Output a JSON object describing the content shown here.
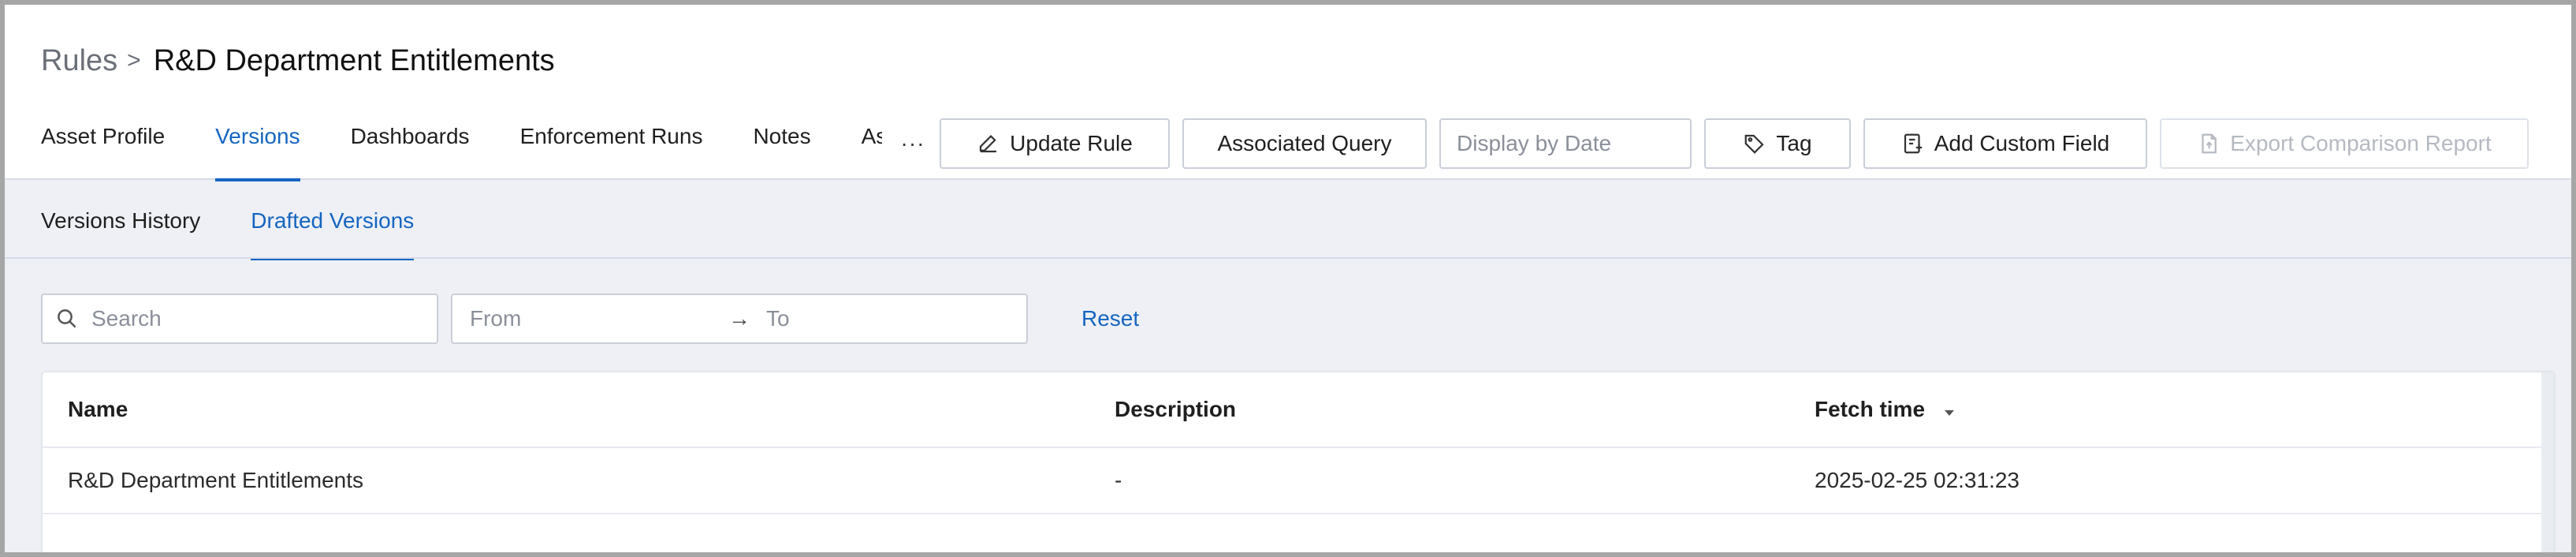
{
  "breadcrumb": {
    "root": "Rules",
    "separator": ">",
    "current": "R&D Department Entitlements"
  },
  "tabs": [
    {
      "label": "Asset Profile",
      "active": false
    },
    {
      "label": "Versions",
      "active": true
    },
    {
      "label": "Dashboards",
      "active": false
    },
    {
      "label": "Enforcement Runs",
      "active": false
    },
    {
      "label": "Notes",
      "active": false
    },
    {
      "label": "As",
      "active": false
    }
  ],
  "toolbar": {
    "more_label": "···",
    "update_rule": "Update Rule",
    "associated_query": "Associated Query",
    "display_by_date_placeholder": "Display by Date",
    "tag": "Tag",
    "add_custom_field": "Add Custom Field",
    "export_comparison_report": "Export Comparison Report"
  },
  "subtabs": [
    {
      "label": "Versions History",
      "active": false
    },
    {
      "label": "Drafted Versions",
      "active": true
    }
  ],
  "filters": {
    "search_placeholder": "Search",
    "from_placeholder": "From",
    "arrow": "→",
    "to_placeholder": "To",
    "reset": "Reset"
  },
  "table": {
    "columns": [
      "Name",
      "Description",
      "Fetch time"
    ],
    "sort_column": "Fetch time",
    "sort_direction": "descending",
    "rows": [
      [
        "R&D Department Entitlements",
        "-",
        "2025-02-25 02:31:23"
      ]
    ]
  },
  "colors": {
    "accent": "#1565c0",
    "background": "#eef0f5",
    "border": "#c9ced8"
  }
}
